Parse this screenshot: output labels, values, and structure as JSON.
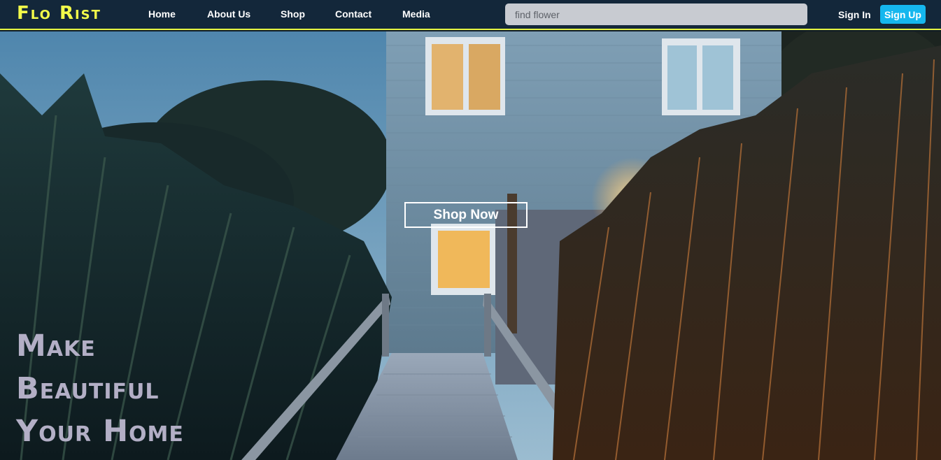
{
  "brand": {
    "logo": "Flo Rist",
    "accent": "#f2fb4a"
  },
  "nav": {
    "links": [
      "Home",
      "About Us",
      "Shop",
      "Contact",
      "Media"
    ]
  },
  "search": {
    "placeholder": "find flower",
    "value": ""
  },
  "auth": {
    "signin_label": "Sign In",
    "signup_label": "Sign Up",
    "signup_color": "#15b7ee"
  },
  "hero": {
    "cta_label": "Shop Now",
    "tagline": [
      "Make",
      "Beautiful",
      "Your Home"
    ]
  }
}
